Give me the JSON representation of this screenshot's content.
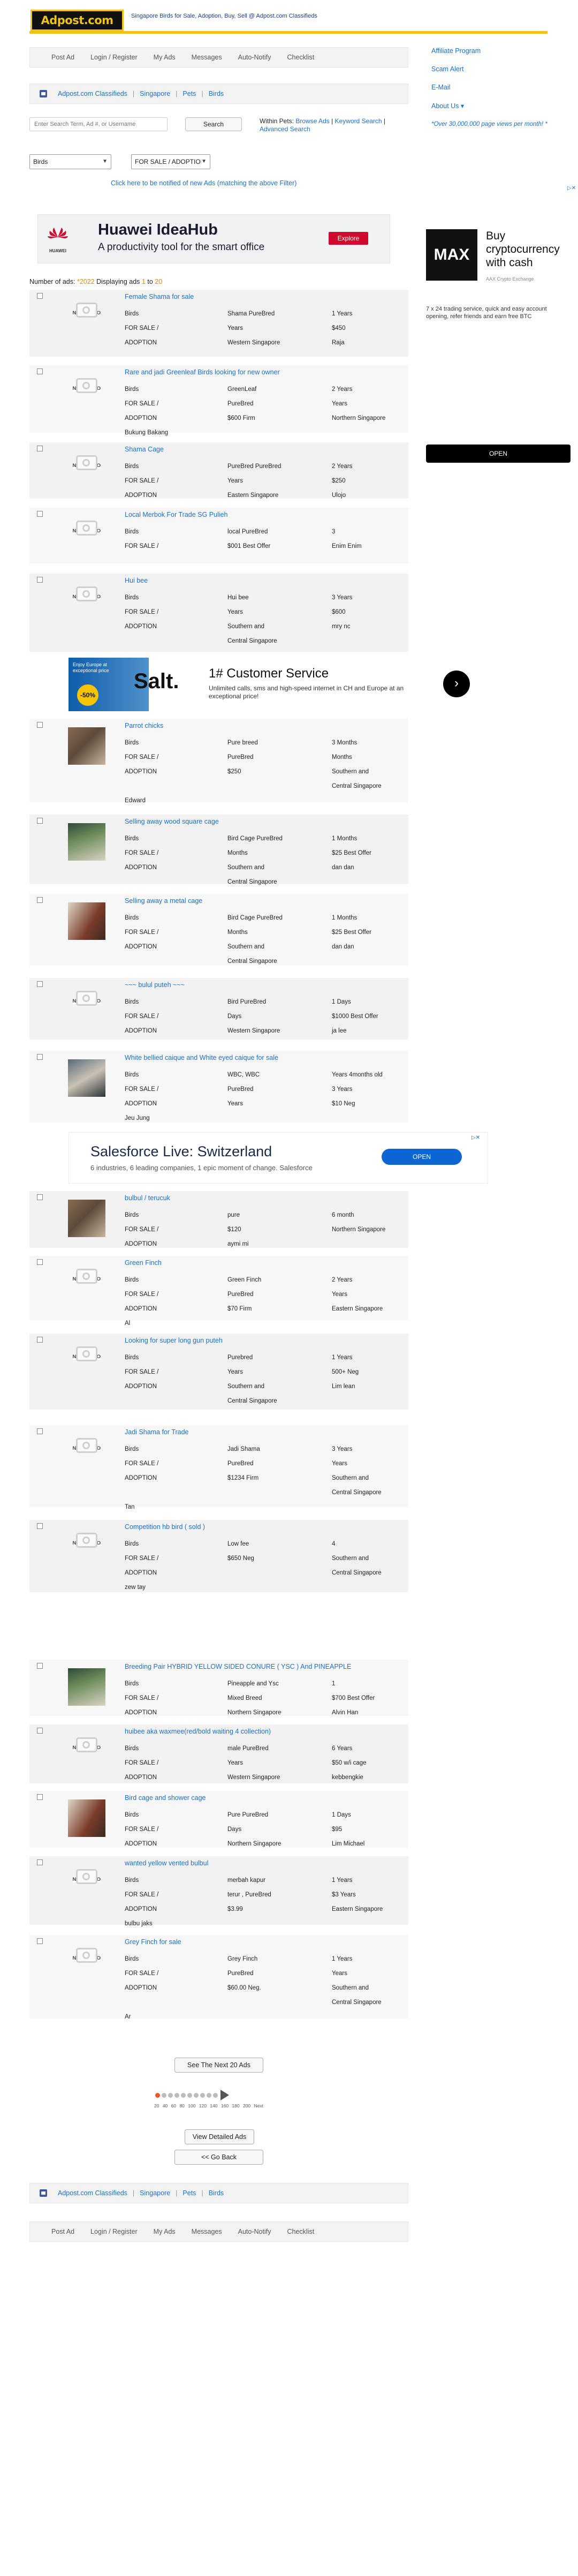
{
  "header": {
    "logo_text": "Adpost.com",
    "tagline": "Singapore Birds for Sale, Adoption, Buy, Sell @ Adpost.com Classifieds"
  },
  "nav": {
    "items": [
      "Post Ad",
      "Login / Register",
      "My Ads",
      "Messages",
      "Auto-Notify",
      "Checklist"
    ]
  },
  "breadcrumb": [
    "Adpost.com Classifieds",
    "Singapore",
    "Pets",
    "Birds"
  ],
  "search": {
    "placeholder": "Enter Search Term, Ad #, or Username",
    "button": "Search",
    "within_label": "Within Pets:",
    "browse": "Browse Ads",
    "keyword": "Keyword Search",
    "advanced": "Advanced Search"
  },
  "filters": {
    "category_value": "Birds",
    "type_value": "FOR SALE / ADOPTION",
    "notify_link": "Click here to be notified of new Ads (matching the above Filter)"
  },
  "right_links": {
    "affiliate": "Affiliate Program",
    "scam": "Scam Alert",
    "email": "E-Mail",
    "about": "About Us ▾",
    "note": "*Over 30,000,000 page views per month! *"
  },
  "ads": {
    "huawei": {
      "brand": "HUAWEI",
      "title": "Huawei IdeaHub",
      "subtitle": "A productivity tool for the smart office",
      "cta": "Explore"
    },
    "max": {
      "brand": "MAX",
      "title": "Buy cryptocurrency with cash",
      "sponsor": "AAX Crypto Exchange",
      "desc": "7 x 24 trading service, quick and easy account opening, refer friends and earn free BTC",
      "cta": "OPEN"
    },
    "salt": {
      "brand": "Salt.",
      "headline": "1# Customer Service",
      "text": "Unlimited calls, sms and high-speed internet in CH and Europe at an exceptional price!",
      "side": "Enjoy Europe at exceptional price",
      "badge": "-50%"
    },
    "sf": {
      "title": "Salesforce Live: Switzerland",
      "text": "6 industries, 6 leading companies, 1 epic moment of change. Salesforce",
      "cta": "OPEN"
    }
  },
  "counts": {
    "prefix": "Number of ads:",
    "total": "*2022",
    "middle": "Displaying ads",
    "from": "1",
    "to_word": "to",
    "to": "20"
  },
  "listings": [
    {
      "title": "Female Shama for sale",
      "photo": false,
      "rows": [
        [
          "Birds",
          "Shama PureBred",
          "1 Years"
        ],
        [
          "FOR SALE /",
          "Years",
          "$450"
        ],
        [
          "ADOPTION",
          "Western Singapore",
          "Raja"
        ]
      ],
      "footer": ""
    },
    {
      "title": "Rare and jadi Greenleaf Birds looking for new owner",
      "photo": false,
      "rows": [
        [
          "Birds",
          "GreenLeaf",
          "2 Years"
        ],
        [
          "FOR SALE /",
          "PureBred",
          "Years"
        ],
        [
          "ADOPTION",
          "$600 Firm",
          "Northern Singapore"
        ]
      ],
      "footer": "Bukung Bakang"
    },
    {
      "title": "Shama Cage",
      "photo": false,
      "rows": [
        [
          "Birds",
          "PureBred PureBred",
          "2 Years"
        ],
        [
          "FOR SALE /",
          "Years",
          "$250"
        ],
        [
          "ADOPTION",
          "Eastern Singapore",
          "Ulojo"
        ]
      ],
      "footer": ""
    },
    {
      "title": "Local Merbok For Trade SG Pulieh",
      "photo": false,
      "rows": [
        [
          "Birds",
          "local PureBred",
          "3"
        ],
        [
          "FOR SALE /",
          "$001 Best Offer",
          "Enim Enim"
        ]
      ],
      "footer": ""
    },
    {
      "title": "Hui bee",
      "photo": false,
      "rows": [
        [
          "Birds",
          "Hui bee",
          "3 Years"
        ],
        [
          "FOR SALE /",
          "Years",
          "$600"
        ],
        [
          "ADOPTION",
          "Southern and",
          "mry nc"
        ],
        [
          "",
          "Central Singapore",
          ""
        ]
      ],
      "footer": ""
    },
    {
      "title": "Parrot chicks",
      "photo": true,
      "rows": [
        [
          "Birds",
          "Pure breed",
          "3 Months"
        ],
        [
          "FOR SALE /",
          "PureBred",
          "Months"
        ],
        [
          "ADOPTION",
          "$250",
          "Southern and"
        ],
        [
          "",
          "",
          "Central Singapore"
        ]
      ],
      "footer": "Edward"
    },
    {
      "title": "Selling away wood square cage",
      "photo": true,
      "rows": [
        [
          "Birds",
          "Bird Cage PureBred",
          "1 Months"
        ],
        [
          "FOR SALE /",
          "Months",
          "$25 Best Offer"
        ],
        [
          "ADOPTION",
          "Southern and",
          "dan dan"
        ],
        [
          "",
          "Central Singapore",
          ""
        ]
      ],
      "footer": ""
    },
    {
      "title": "Selling away a metal cage",
      "photo": true,
      "rows": [
        [
          "Birds",
          "Bird Cage PureBred",
          "1 Months"
        ],
        [
          "FOR SALE /",
          "Months",
          "$25 Best Offer"
        ],
        [
          "ADOPTION",
          "Southern and",
          "dan dan"
        ],
        [
          "",
          "Central Singapore",
          ""
        ]
      ],
      "footer": ""
    },
    {
      "title": "~~~ bulul puteh ~~~",
      "photo": false,
      "rows": [
        [
          "Birds",
          "Bird PureBred",
          "1 Days"
        ],
        [
          "FOR SALE /",
          "Days",
          "$1000 Best Offer"
        ],
        [
          "ADOPTION",
          "Western Singapore",
          "ja lee"
        ]
      ],
      "footer": ""
    },
    {
      "title": "White bellied caique and White eyed caique for sale",
      "photo": true,
      "rows": [
        [
          "Birds",
          "WBC, WBC",
          "Years 4months old"
        ],
        [
          "FOR SALE /",
          "PureBred",
          "3 Years"
        ],
        [
          "ADOPTION",
          "Years",
          "$10 Neg"
        ]
      ],
      "footer": "Jeu Jung"
    },
    {
      "title": "bulbul / terucuk",
      "photo": true,
      "rows": [
        [
          "Birds",
          "pure",
          "6 month"
        ],
        [
          "FOR SALE /",
          "$120",
          "Northern Singapore"
        ],
        [
          "ADOPTION",
          "aymi mi",
          ""
        ]
      ],
      "footer": ""
    },
    {
      "title": "Green Finch",
      "photo": false,
      "rows": [
        [
          "Birds",
          "Green Finch",
          "2 Years"
        ],
        [
          "FOR SALE /",
          "PureBred",
          "Years"
        ],
        [
          "ADOPTION",
          "$70 Firm",
          "Eastern Singapore"
        ]
      ],
      "footer": "Al"
    },
    {
      "title": "Looking for super long gun puteh",
      "photo": false,
      "rows": [
        [
          "Birds",
          "Purebred",
          "1 Years"
        ],
        [
          "FOR SALE /",
          "Years",
          "500+ Neg"
        ],
        [
          "ADOPTION",
          "Southern and",
          "Lim lean"
        ],
        [
          "",
          "Central Singapore",
          ""
        ]
      ],
      "footer": ""
    },
    {
      "title": "Jadi Shama for Trade",
      "photo": false,
      "rows": [
        [
          "Birds",
          "Jadi Shama",
          "3 Years"
        ],
        [
          "FOR SALE /",
          "PureBred",
          "Years"
        ],
        [
          "ADOPTION",
          "$1234 Firm",
          "Southern and"
        ],
        [
          "",
          "",
          "Central Singapore"
        ]
      ],
      "footer": "Tan"
    },
    {
      "title": "Competition hb bird ( sold )",
      "photo": false,
      "rows": [
        [
          "Birds",
          "Low fee",
          "4"
        ],
        [
          "FOR SALE /",
          "$650 Neg",
          "Southern and"
        ],
        [
          "ADOPTION",
          "",
          "Central Singapore"
        ]
      ],
      "footer": "zew tay"
    },
    {
      "title": "Breeding Pair HYBRID YELLOW SIDED CONURE ( YSC ) And PINEAPPLE",
      "photo": true,
      "rows": [
        [
          "Birds",
          "Pineapple and Ysc",
          "1"
        ],
        [
          "FOR SALE /",
          "Mixed Breed",
          "$700 Best Offer"
        ],
        [
          "ADOPTION",
          "Northern Singapore",
          "Alvin Han"
        ]
      ],
      "footer": ""
    },
    {
      "title": "huibee aka waxmee(red/bold waiting 4 collection)",
      "photo": false,
      "rows": [
        [
          "Birds",
          "male PureBred",
          "6 Years"
        ],
        [
          "FOR SALE /",
          "Years",
          "$50 w/i cage"
        ],
        [
          "ADOPTION",
          "Western Singapore",
          "kebbengkie"
        ]
      ],
      "footer": ""
    },
    {
      "title": "Bird cage and shower cage",
      "photo": true,
      "rows": [
        [
          "Birds",
          "Pure PureBred",
          "1 Days"
        ],
        [
          "FOR SALE /",
          "Days",
          "$95"
        ],
        [
          "ADOPTION",
          "Northern Singapore",
          "Lim Michael"
        ]
      ],
      "footer": ""
    },
    {
      "title": "wanted yellow vented bulbul",
      "photo": false,
      "rows": [
        [
          "Birds",
          "merbah kapur",
          "1 Years"
        ],
        [
          "FOR SALE /",
          "terur , PureBred",
          "$3 Years"
        ],
        [
          "ADOPTION",
          "$3.99",
          "Eastern Singapore"
        ]
      ],
      "footer": "bulbu jaks"
    },
    {
      "title": "Grey Finch for sale",
      "photo": false,
      "rows": [
        [
          "Birds",
          "Grey Finch",
          "1 Years"
        ],
        [
          "FOR SALE /",
          "PureBred",
          "Years"
        ],
        [
          "ADOPTION",
          "$60.00 Neg.",
          "Southern and"
        ],
        [
          "",
          "",
          "Central Singapore"
        ]
      ],
      "footer": "Ar"
    }
  ],
  "no_photo_label": "NO PHOTO",
  "bottom": {
    "next": "See The Next 20 Ads",
    "pages": "20 40 60 80 100 120 140 160 180 200 Next",
    "detailed": "View Detailed Ads",
    "back": "<< Go Back"
  },
  "colors": {
    "brand_yellow": "#f2c11c",
    "link_blue": "#1e6fc6",
    "count_orange": "#f08c00"
  }
}
